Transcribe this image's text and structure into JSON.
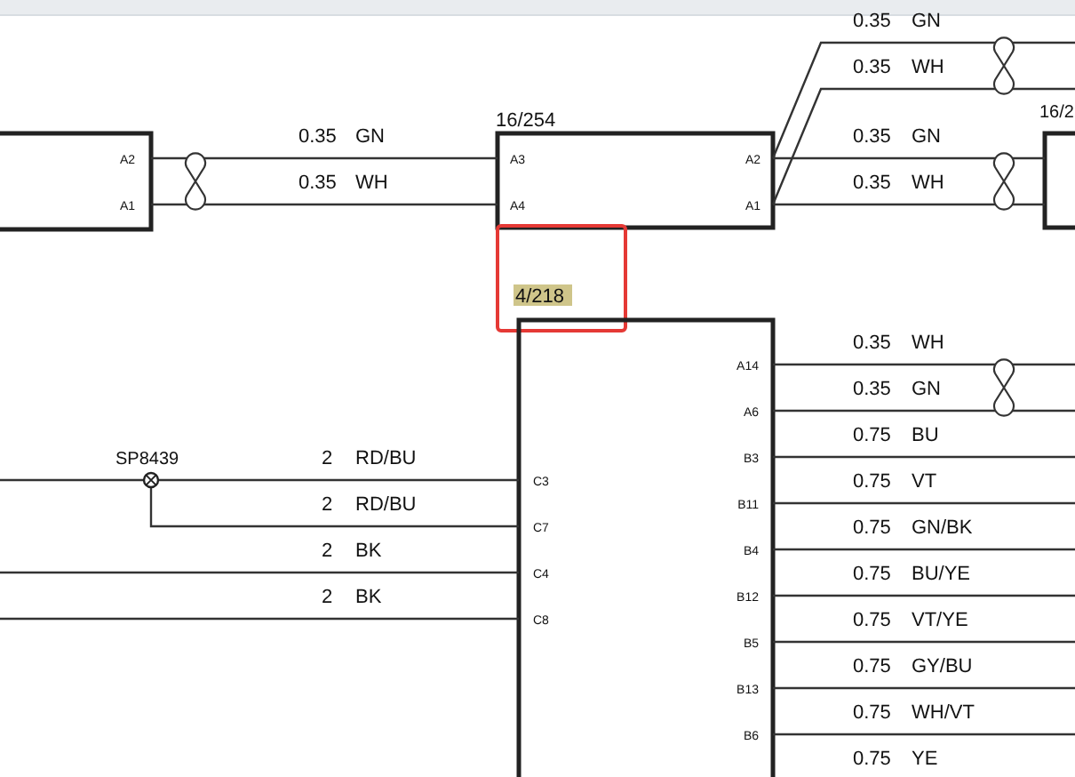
{
  "connectors": [
    {
      "kind": "left",
      "pins_right": [
        "A2",
        "A1"
      ]
    },
    {
      "kind": "middle",
      "label": "16/254",
      "pins_left": [
        "A3",
        "A4"
      ],
      "pins_right": [
        "A2",
        "A1"
      ]
    },
    {
      "kind": "right",
      "label": "16/2"
    },
    {
      "kind": "module",
      "label": "4/218",
      "highlighted": true,
      "pins_left": [
        "C3",
        "C7",
        "C4",
        "C8"
      ],
      "pins_right": [
        "A14",
        "A6",
        "B3",
        "B11",
        "B4",
        "B12",
        "B5",
        "B13",
        "B6"
      ]
    }
  ],
  "wire_groups": [
    {
      "kind": "left_pair",
      "twisted_pair": true,
      "wires": [
        {
          "size": "0.35",
          "code": "GN"
        },
        {
          "size": "0.35",
          "code": "WH"
        }
      ]
    },
    {
      "kind": "upper_branch",
      "twisted_pair": true,
      "wires": [
        {
          "size": "0.35",
          "code": "GN"
        },
        {
          "size": "0.35",
          "code": "WH"
        }
      ]
    },
    {
      "kind": "right_pair",
      "twisted_pair": true,
      "wires": [
        {
          "size": "0.35",
          "code": "GN"
        },
        {
          "size": "0.35",
          "code": "WH"
        }
      ]
    },
    {
      "kind": "module_right",
      "twisted_pair": true,
      "wires": [
        {
          "size": "0.35",
          "code": "WH"
        },
        {
          "size": "0.35",
          "code": "GN"
        },
        {
          "size": "0.75",
          "code": "BU"
        },
        {
          "size": "0.75",
          "code": "VT"
        },
        {
          "size": "0.75",
          "code": "GN/BK"
        },
        {
          "size": "0.75",
          "code": "BU/YE"
        },
        {
          "size": "0.75",
          "code": "VT/YE"
        },
        {
          "size": "0.75",
          "code": "GY/BU"
        },
        {
          "size": "0.75",
          "code": "WH/VT"
        },
        {
          "size": "0.75",
          "code": "YE"
        }
      ]
    },
    {
      "kind": "module_left",
      "splice": "SP8439",
      "wires": [
        {
          "size": "2",
          "code": "RD/BU"
        },
        {
          "size": "2",
          "code": "RD/BU"
        },
        {
          "size": "2",
          "code": "BK"
        },
        {
          "size": "2",
          "code": "BK"
        }
      ]
    }
  ]
}
